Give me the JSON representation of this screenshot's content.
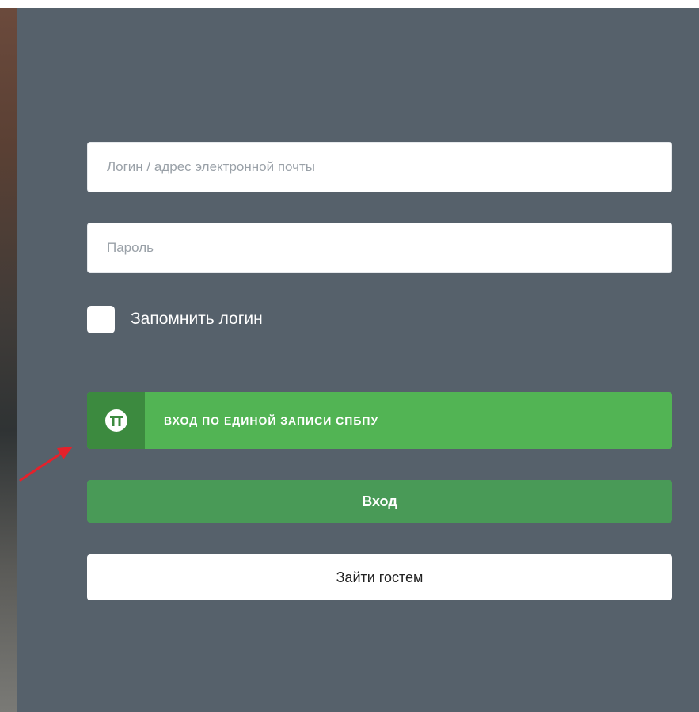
{
  "form": {
    "login_placeholder": "Логин / адрес электронной почты",
    "login_value": "",
    "password_placeholder": "Пароль",
    "password_value": "",
    "remember_label": "Запомнить логин",
    "remember_checked": false
  },
  "sso": {
    "label": "вход по единой записи СПбПУ",
    "icon": "polytech-logo-icon"
  },
  "buttons": {
    "login_label": "Вход",
    "guest_label": "Зайти гостем"
  },
  "annotation": {
    "icon": "red-arrow-icon",
    "color": "#e5212b"
  },
  "colors": {
    "panel": "#56616b",
    "sso_green": "#52b454",
    "sso_icon_bg": "#3c8a3f",
    "login_green": "#499a57"
  }
}
